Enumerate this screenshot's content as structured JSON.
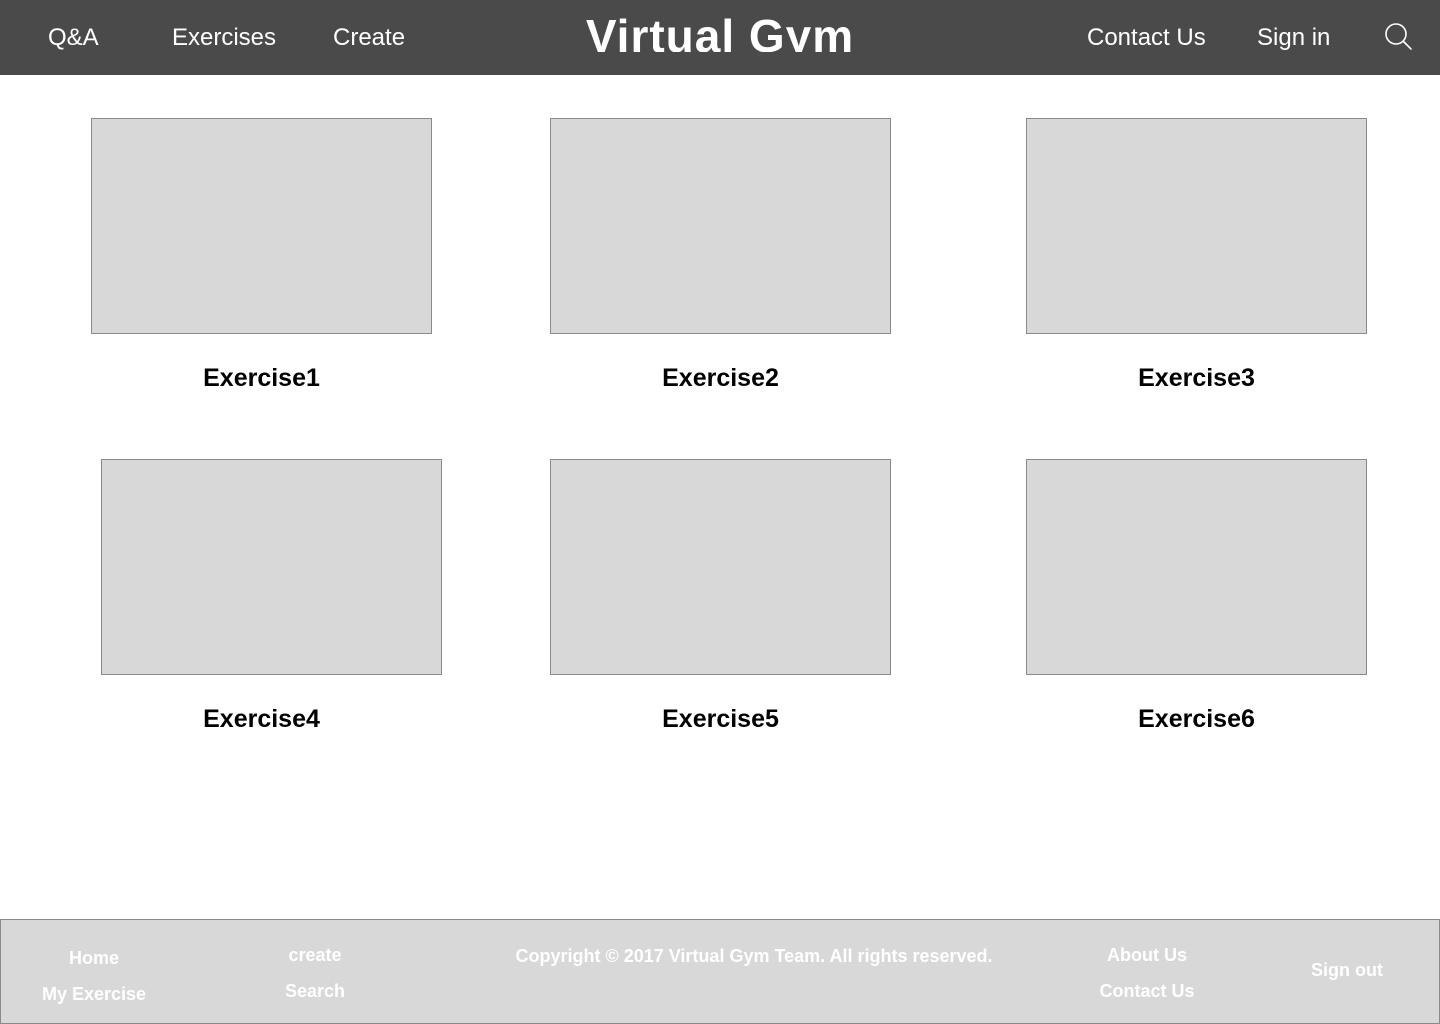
{
  "header": {
    "nav_left": [
      "Q&A",
      "Exercises",
      "Create"
    ],
    "brand": "Virtual Gym",
    "nav_right": [
      "Contact Us",
      "Sign in"
    ],
    "search_icon": "search-icon",
    "background_color": "#4a4a4a"
  },
  "exercises": [
    {
      "title": "Exercise1"
    },
    {
      "title": "Exercise2"
    },
    {
      "title": "Exercise3"
    },
    {
      "title": "Exercise4"
    },
    {
      "title": "Exercise5"
    },
    {
      "title": "Exercise6"
    }
  ],
  "footer": {
    "col1": [
      "Home",
      "My Exercise"
    ],
    "col2": [
      "create",
      "Search"
    ],
    "copyright": "Copyright © 2017 Virtual Gym Team. All rights reserved.",
    "col3": [
      "About Us",
      "Contact Us"
    ],
    "col4": [
      "Sign out"
    ],
    "background_color": "#d8d8d8"
  }
}
